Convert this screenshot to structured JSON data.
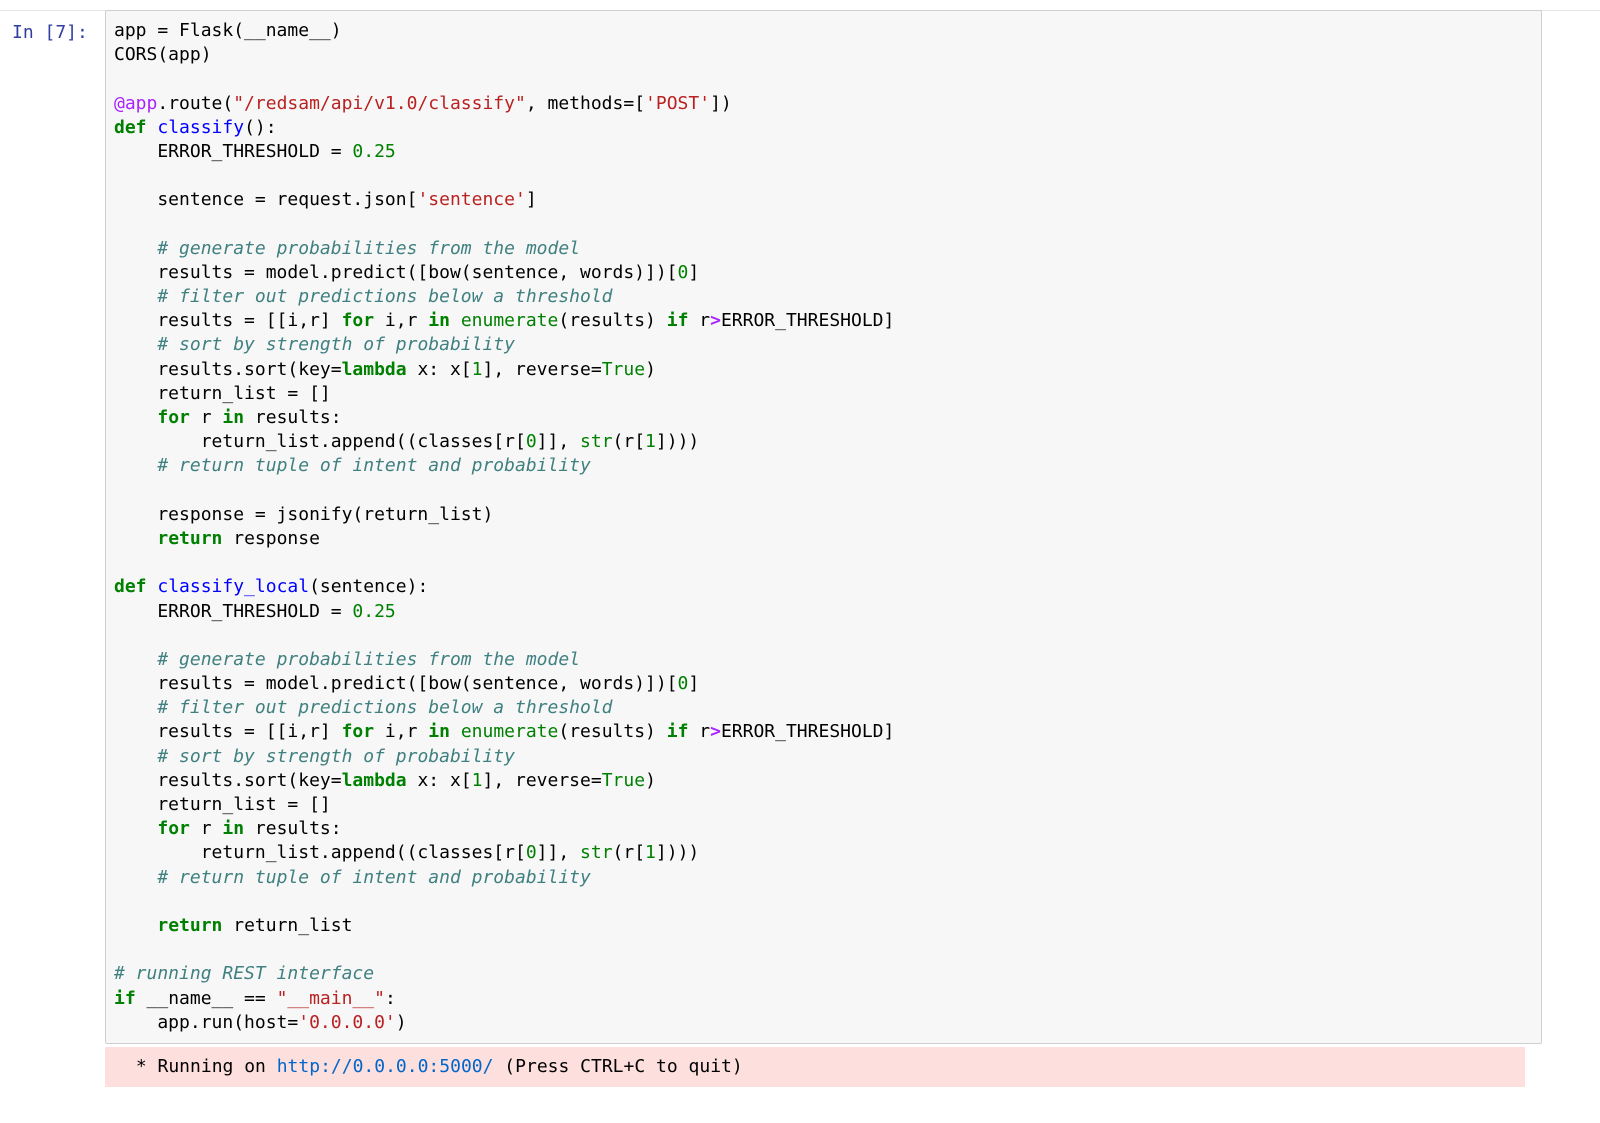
{
  "cell": {
    "prompt": "In [7]:",
    "lines": [
      [
        {
          "t": "app = Flask(__name__)"
        }
      ],
      [
        {
          "t": "CORS(app)"
        }
      ],
      [],
      [
        {
          "t": "@app",
          "c": "dec"
        },
        {
          "t": ".route("
        },
        {
          "t": "\"/redsam/api/v1.0/classify\"",
          "c": "str"
        },
        {
          "t": ", methods=["
        },
        {
          "t": "'POST'",
          "c": "str"
        },
        {
          "t": "])"
        }
      ],
      [
        {
          "t": "def",
          "c": "kw"
        },
        {
          "t": " "
        },
        {
          "t": "classify",
          "c": "fn"
        },
        {
          "t": "():"
        }
      ],
      [
        {
          "t": "    ERROR_THRESHOLD = "
        },
        {
          "t": "0.25",
          "c": "num"
        }
      ],
      [],
      [
        {
          "t": "    sentence = request.json["
        },
        {
          "t": "'sentence'",
          "c": "str"
        },
        {
          "t": "]"
        }
      ],
      [],
      [
        {
          "t": "    "
        },
        {
          "t": "# generate probabilities from the model",
          "c": "com"
        }
      ],
      [
        {
          "t": "    results = model.predict([bow(sentence, words)])["
        },
        {
          "t": "0",
          "c": "num"
        },
        {
          "t": "]"
        }
      ],
      [
        {
          "t": "    "
        },
        {
          "t": "# filter out predictions below a threshold",
          "c": "com"
        }
      ],
      [
        {
          "t": "    results = [[i,r] "
        },
        {
          "t": "for",
          "c": "kw"
        },
        {
          "t": " i,r "
        },
        {
          "t": "in",
          "c": "kw"
        },
        {
          "t": " "
        },
        {
          "t": "enumerate",
          "c": "bi"
        },
        {
          "t": "(results) "
        },
        {
          "t": "if",
          "c": "kw"
        },
        {
          "t": " r"
        },
        {
          "t": ">",
          "c": "op"
        },
        {
          "t": "ERROR_THRESHOLD]"
        }
      ],
      [
        {
          "t": "    "
        },
        {
          "t": "# sort by strength of probability",
          "c": "com"
        }
      ],
      [
        {
          "t": "    results.sort(key="
        },
        {
          "t": "lambda",
          "c": "kw"
        },
        {
          "t": " x: x["
        },
        {
          "t": "1",
          "c": "num"
        },
        {
          "t": "], reverse="
        },
        {
          "t": "True",
          "c": "bi"
        },
        {
          "t": ")"
        }
      ],
      [
        {
          "t": "    return_list = []"
        }
      ],
      [
        {
          "t": "    "
        },
        {
          "t": "for",
          "c": "kw"
        },
        {
          "t": " r "
        },
        {
          "t": "in",
          "c": "kw"
        },
        {
          "t": " results:"
        }
      ],
      [
        {
          "t": "        return_list.append((classes[r["
        },
        {
          "t": "0",
          "c": "num"
        },
        {
          "t": "]], "
        },
        {
          "t": "str",
          "c": "bi"
        },
        {
          "t": "(r["
        },
        {
          "t": "1",
          "c": "num"
        },
        {
          "t": "])))"
        }
      ],
      [
        {
          "t": "    "
        },
        {
          "t": "# return tuple of intent and probability",
          "c": "com"
        }
      ],
      [],
      [
        {
          "t": "    response = jsonify(return_list)"
        }
      ],
      [
        {
          "t": "    "
        },
        {
          "t": "return",
          "c": "kw"
        },
        {
          "t": " response"
        }
      ],
      [],
      [
        {
          "t": "def",
          "c": "kw"
        },
        {
          "t": " "
        },
        {
          "t": "classify_local",
          "c": "fn"
        },
        {
          "t": "(sentence):"
        }
      ],
      [
        {
          "t": "    ERROR_THRESHOLD = "
        },
        {
          "t": "0.25",
          "c": "num"
        }
      ],
      [],
      [
        {
          "t": "    "
        },
        {
          "t": "# generate probabilities from the model",
          "c": "com"
        }
      ],
      [
        {
          "t": "    results = model.predict([bow(sentence, words)])["
        },
        {
          "t": "0",
          "c": "num"
        },
        {
          "t": "]"
        }
      ],
      [
        {
          "t": "    "
        },
        {
          "t": "# filter out predictions below a threshold",
          "c": "com"
        }
      ],
      [
        {
          "t": "    results = [[i,r] "
        },
        {
          "t": "for",
          "c": "kw"
        },
        {
          "t": " i,r "
        },
        {
          "t": "in",
          "c": "kw"
        },
        {
          "t": " "
        },
        {
          "t": "enumerate",
          "c": "bi"
        },
        {
          "t": "(results) "
        },
        {
          "t": "if",
          "c": "kw"
        },
        {
          "t": " r"
        },
        {
          "t": ">",
          "c": "op"
        },
        {
          "t": "ERROR_THRESHOLD]"
        }
      ],
      [
        {
          "t": "    "
        },
        {
          "t": "# sort by strength of probability",
          "c": "com"
        }
      ],
      [
        {
          "t": "    results.sort(key="
        },
        {
          "t": "lambda",
          "c": "kw"
        },
        {
          "t": " x: x["
        },
        {
          "t": "1",
          "c": "num"
        },
        {
          "t": "], reverse="
        },
        {
          "t": "True",
          "c": "bi"
        },
        {
          "t": ")"
        }
      ],
      [
        {
          "t": "    return_list = []"
        }
      ],
      [
        {
          "t": "    "
        },
        {
          "t": "for",
          "c": "kw"
        },
        {
          "t": " r "
        },
        {
          "t": "in",
          "c": "kw"
        },
        {
          "t": " results:"
        }
      ],
      [
        {
          "t": "        return_list.append((classes[r["
        },
        {
          "t": "0",
          "c": "num"
        },
        {
          "t": "]], "
        },
        {
          "t": "str",
          "c": "bi"
        },
        {
          "t": "(r["
        },
        {
          "t": "1",
          "c": "num"
        },
        {
          "t": "])))"
        }
      ],
      [
        {
          "t": "    "
        },
        {
          "t": "# return tuple of intent and probability",
          "c": "com"
        }
      ],
      [],
      [
        {
          "t": "    "
        },
        {
          "t": "return",
          "c": "kw"
        },
        {
          "t": " return_list"
        }
      ],
      [],
      [
        {
          "t": "# running REST interface",
          "c": "com"
        }
      ],
      [
        {
          "t": "if",
          "c": "kw"
        },
        {
          "t": " __name__ == "
        },
        {
          "t": "\"__main__\"",
          "c": "str"
        },
        {
          "t": ":"
        }
      ],
      [
        {
          "t": "    app.run(host="
        },
        {
          "t": "'0.0.0.0'",
          "c": "str"
        },
        {
          "t": ")"
        }
      ]
    ]
  },
  "output": {
    "prefix": " * Running on ",
    "url": "http://0.0.0.0:5000/",
    "suffix": " (Press CTRL+C to quit)"
  },
  "colors": {
    "keyword": "#008000",
    "function_name": "#0000ff",
    "string": "#ba2121",
    "comment": "#408080",
    "decorator": "#aa22ff",
    "prompt": "#303f9f",
    "cell_background": "#f7f7f7",
    "stderr_background": "#fddfdd"
  }
}
